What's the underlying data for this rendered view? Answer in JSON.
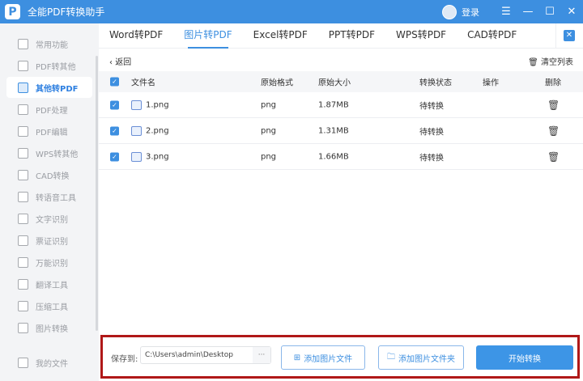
{
  "app": {
    "title": "全能PDF转换助手",
    "login": "登录"
  },
  "sidebar": {
    "items": [
      {
        "label": "常用功能"
      },
      {
        "label": "PDF转其他"
      },
      {
        "label": "其他转PDF",
        "active": true
      },
      {
        "label": "PDF处理"
      },
      {
        "label": "PDF编辑"
      },
      {
        "label": "WPS转其他"
      },
      {
        "label": "CAD转换"
      },
      {
        "label": "转语音工具"
      },
      {
        "label": "文字识别"
      },
      {
        "label": "票证识别"
      },
      {
        "label": "万能识别"
      },
      {
        "label": "翻译工具"
      },
      {
        "label": "压缩工具"
      },
      {
        "label": "图片转换"
      }
    ],
    "my_files": "我的文件"
  },
  "tabs": [
    {
      "label": "Word转PDF"
    },
    {
      "label": "图片转PDF",
      "active": true
    },
    {
      "label": "Excel转PDF"
    },
    {
      "label": "PPT转PDF"
    },
    {
      "label": "WPS转PDF"
    },
    {
      "label": "CAD转PDF"
    }
  ],
  "toolbar": {
    "back": "返回",
    "clear": "清空列表"
  },
  "table": {
    "headers": [
      "文件名",
      "原始格式",
      "原始大小",
      "转换状态",
      "操作",
      "删除"
    ],
    "rows": [
      {
        "name": "1.png",
        "format": "png",
        "size": "1.87MB",
        "status": "待转换"
      },
      {
        "name": "2.png",
        "format": "png",
        "size": "1.31MB",
        "status": "待转换"
      },
      {
        "name": "3.png",
        "format": "png",
        "size": "1.66MB",
        "status": "待转换"
      }
    ]
  },
  "bottom": {
    "save_label": "保存到:",
    "path": "C:\\Users\\admin\\Desktop",
    "dots": "···",
    "add_file": "添加图片文件",
    "add_folder": "添加图片文件夹",
    "start": "开始转换"
  }
}
